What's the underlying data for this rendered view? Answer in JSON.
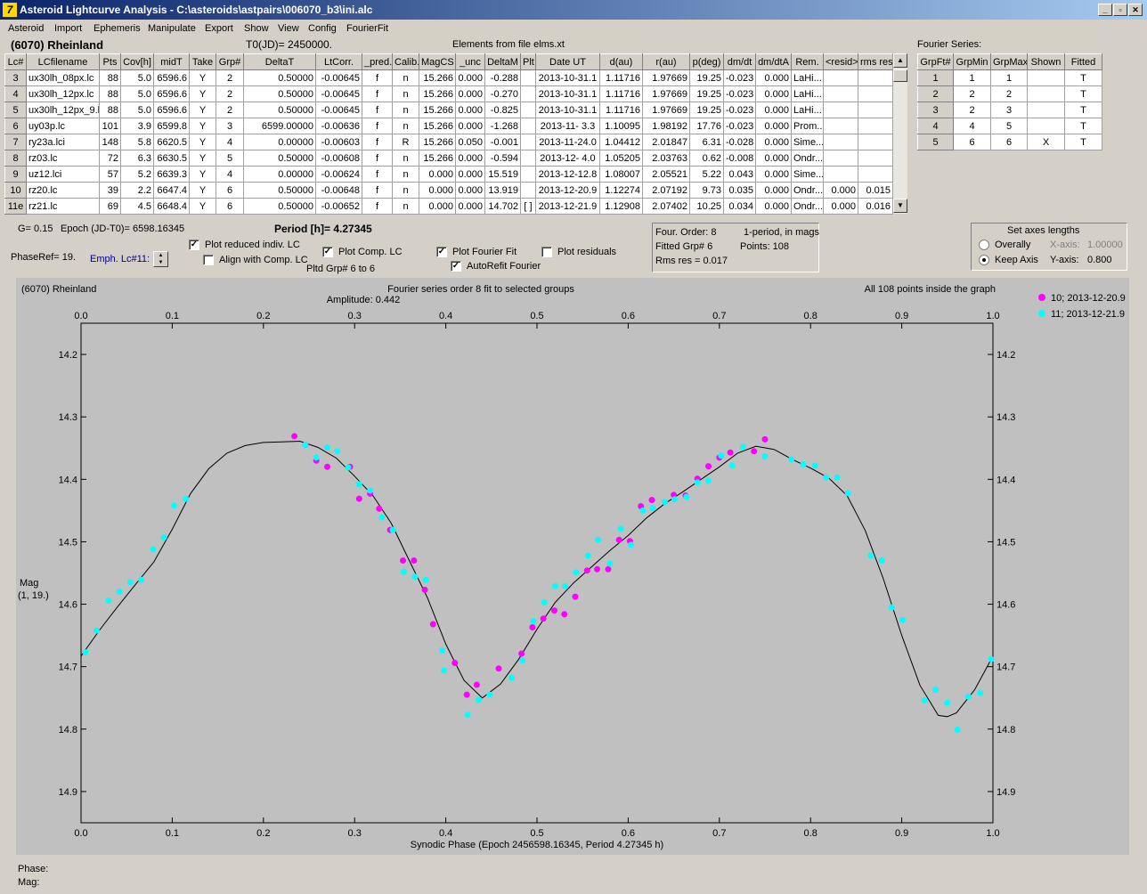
{
  "window": {
    "title": "Asteroid Lightcurve Analysis - C:\\asteroids\\astpairs\\006070_b3\\ini.alc",
    "logo": "7",
    "min": "_",
    "max": "▫",
    "close": "✕"
  },
  "menu": [
    "Asteroid",
    "Import",
    "Ephemeris",
    "Manipulate",
    "Export",
    "Show",
    "View",
    "Config",
    "FourierFit"
  ],
  "info": {
    "asteroid": "(6070) Rheinland",
    "t0": "T0(JD)= 2450000.",
    "elements": "Elements from file elms.xt",
    "fourier_label": "Fourier Series:"
  },
  "lc_table": {
    "headers": [
      "Lc#",
      "LCfilename",
      "Pts",
      "Cov[h]",
      "midT",
      "Take",
      "Grp#",
      "DeltaT",
      "LtCorr.",
      "_pred.",
      "Calib.",
      "MagCS",
      "_unc",
      "DeltaM",
      "Plt",
      "Date UT",
      "d(au)",
      "r(au)",
      "p(deg)",
      "dm/dt",
      "dm/dtA",
      "Rem.",
      "<resid>",
      "rms res"
    ],
    "rows": [
      [
        "3",
        "ux30lh_08px.lc",
        "88",
        "5.0",
        "6596.6",
        "Y",
        "2",
        "0.50000",
        "-0.00645",
        "f",
        "n",
        "15.266",
        "0.000",
        "-0.288",
        "",
        "2013-10-31.1",
        "1.11716",
        "1.97669",
        "19.25",
        "-0.023",
        "0.000",
        "LaHi...",
        "",
        ""
      ],
      [
        "4",
        "ux30lh_12px.lc",
        "88",
        "5.0",
        "6596.6",
        "Y",
        "2",
        "0.50000",
        "-0.00645",
        "f",
        "n",
        "15.266",
        "0.000",
        "-0.270",
        "",
        "2013-10-31.1",
        "1.11716",
        "1.97669",
        "19.25",
        "-0.023",
        "0.000",
        "LaHi...",
        "",
        ""
      ],
      [
        "5",
        "ux30lh_12px_9.l",
        "88",
        "5.0",
        "6596.6",
        "Y",
        "2",
        "0.50000",
        "-0.00645",
        "f",
        "n",
        "15.266",
        "0.000",
        "-0.825",
        "",
        "2013-10-31.1",
        "1.11716",
        "1.97669",
        "19.25",
        "-0.023",
        "0.000",
        "LaHi...",
        "",
        ""
      ],
      [
        "6",
        "uy03p.lc",
        "101",
        "3.9",
        "6599.8",
        "Y",
        "3",
        "6599.00000",
        "-0.00636",
        "f",
        "n",
        "15.266",
        "0.000",
        "-1.268",
        "",
        "2013-11- 3.3",
        "1.10095",
        "1.98192",
        "17.76",
        "-0.023",
        "0.000",
        "Prom...",
        "",
        ""
      ],
      [
        "7",
        "ry23a.lci",
        "148",
        "5.8",
        "6620.5",
        "Y",
        "4",
        "0.00000",
        "-0.00603",
        "f",
        "R",
        "15.266",
        "0.050",
        "-0.001",
        "",
        "2013-11-24.0",
        "1.04412",
        "2.01847",
        "6.31",
        "-0.028",
        "0.000",
        "Sime...",
        "",
        ""
      ],
      [
        "8",
        "rz03.lc",
        "72",
        "6.3",
        "6630.5",
        "Y",
        "5",
        "0.50000",
        "-0.00608",
        "f",
        "n",
        "15.266",
        "0.000",
        "-0.594",
        "",
        "2013-12- 4.0",
        "1.05205",
        "2.03763",
        "0.62",
        "-0.008",
        "0.000",
        "Ondr...",
        "",
        ""
      ],
      [
        "9",
        "uz12.lci",
        "57",
        "5.2",
        "6639.3",
        "Y",
        "4",
        "0.00000",
        "-0.00624",
        "f",
        "n",
        "0.000",
        "0.000",
        "15.519",
        "",
        "2013-12-12.8",
        "1.08007",
        "2.05521",
        "5.22",
        "0.043",
        "0.000",
        "Sime...",
        "",
        ""
      ],
      [
        "10",
        "rz20.lc",
        "39",
        "2.2",
        "6647.4",
        "Y",
        "6",
        "0.50000",
        "-0.00648",
        "f",
        "n",
        "0.000",
        "0.000",
        "13.919",
        "",
        "2013-12-20.9",
        "1.12274",
        "2.07192",
        "9.73",
        "0.035",
        "0.000",
        "Ondr...",
        "0.000",
        "0.015"
      ],
      [
        "11e",
        "rz21.lc",
        "69",
        "4.5",
        "6648.4",
        "Y",
        "6",
        "0.50000",
        "-0.00652",
        "f",
        "n",
        "0.000",
        "0.000",
        "14.702",
        "[ ]",
        "2013-12-21.9",
        "1.12908",
        "2.07402",
        "10.25",
        "0.034",
        "0.000",
        "Ondr...",
        "0.000",
        "0.016"
      ]
    ]
  },
  "fourier_table": {
    "headers": [
      "GrpFt#",
      "GrpMin",
      "GrpMax",
      "Shown",
      "Fitted"
    ],
    "rows": [
      [
        "1",
        "1",
        "1",
        "",
        "T"
      ],
      [
        "2",
        "2",
        "2",
        "",
        "T"
      ],
      [
        "3",
        "2",
        "3",
        "",
        "T"
      ],
      [
        "4",
        "4",
        "5",
        "",
        "T"
      ],
      [
        "5",
        "6",
        "6",
        "X",
        "T"
      ]
    ]
  },
  "controls": {
    "g": "G= 0.15",
    "epoch": "Epoch (JD-T0)= 6598.16345",
    "period": "Period [h]= 4.27345",
    "phaseref": "PhaseRef= 19.",
    "emph": "Emph. Lc#11:",
    "plot_reduced": "Plot reduced indiv. LC",
    "align": "Align with Comp. LC",
    "plot_comp": "Plot Comp. LC",
    "pltd_grp": "Pltd Grp#  6  to  6",
    "plot_fourier": "Plot Fourier Fit",
    "autorefit": "AutoRefit Fourier",
    "plot_resid": "Plot residuals",
    "checked": {
      "plot_reduced": true,
      "align": false,
      "plot_comp": true,
      "plot_fourier": true,
      "autorefit": true,
      "plot_resid": false
    }
  },
  "fit_info": {
    "order": "Four. Order:  8",
    "fitted": "Fitted Grp# 6",
    "rms": "Rms res     = 0.017",
    "mode": "1-period, in mags",
    "points": "Points: 108"
  },
  "axes_box": {
    "title": "Set axes lengths",
    "overall": "Overally",
    "keep": "Keep Axis",
    "xaxis": "X-axis:",
    "xval": "1.00000",
    "yaxis": "Y-axis:",
    "yval": "0.800",
    "selected": "keep"
  },
  "chart_data": {
    "type": "scatter",
    "title_left": "(6070) Rheinland",
    "title": "Fourier series order 8 fit to selected groups",
    "subtitle": "Amplitude: 0.442",
    "title_right": "All 108 points inside the graph",
    "xlabel": "Synodic Phase (Epoch 2456598.16345, Period 4.27345 h)",
    "ylabel": "Mag",
    "ylabel2": "(1, 19.)",
    "xlim": [
      0,
      1
    ],
    "ylim": [
      14.15,
      14.95
    ],
    "y_inverted": true,
    "xticks": [
      0.0,
      0.1,
      0.2,
      0.3,
      0.4,
      0.5,
      0.6,
      0.7,
      0.8,
      0.9,
      1.0
    ],
    "xtick_labels": [
      "0.0",
      "0.1",
      "0.2",
      "0.3",
      "0.4",
      "0.5",
      "0.6",
      "0.7",
      "0.8",
      "0.9",
      "1.0"
    ],
    "yticks": [
      14.2,
      14.3,
      14.4,
      14.5,
      14.6,
      14.7,
      14.8,
      14.9
    ],
    "ytick_labels": [
      "14.2",
      "14.3",
      "14.4",
      "14.5",
      "14.6",
      "14.7",
      "14.8",
      "14.9"
    ],
    "legend": "right",
    "series": [
      {
        "name": "10; 2013-12-20.9",
        "color": "#ff00ff",
        "points": [
          [
            0.234,
            14.331
          ],
          [
            0.246,
            14.345
          ],
          [
            0.258,
            14.37
          ],
          [
            0.27,
            14.38
          ],
          [
            0.295,
            14.38
          ],
          [
            0.305,
            14.431
          ],
          [
            0.317,
            14.423
          ],
          [
            0.327,
            14.447
          ],
          [
            0.339,
            14.481
          ],
          [
            0.353,
            14.53
          ],
          [
            0.365,
            14.53
          ],
          [
            0.377,
            14.577
          ],
          [
            0.386,
            14.632
          ],
          [
            0.41,
            14.694
          ],
          [
            0.423,
            14.745
          ],
          [
            0.434,
            14.729
          ],
          [
            0.458,
            14.703
          ],
          [
            0.483,
            14.679
          ],
          [
            0.495,
            14.637
          ],
          [
            0.507,
            14.623
          ],
          [
            0.519,
            14.61
          ],
          [
            0.53,
            14.616
          ],
          [
            0.542,
            14.588
          ],
          [
            0.555,
            14.546
          ],
          [
            0.566,
            14.544
          ],
          [
            0.578,
            14.544
          ],
          [
            0.59,
            14.497
          ],
          [
            0.602,
            14.499
          ],
          [
            0.614,
            14.443
          ],
          [
            0.626,
            14.433
          ],
          [
            0.65,
            14.425
          ],
          [
            0.663,
            14.426
          ],
          [
            0.676,
            14.399
          ],
          [
            0.688,
            14.379
          ],
          [
            0.7,
            14.365
          ],
          [
            0.712,
            14.357
          ],
          [
            0.738,
            14.355
          ],
          [
            0.75,
            14.336
          ]
        ]
      },
      {
        "name": "11; 2013-12-21.9",
        "color": "#00ffff",
        "points": [
          [
            0.005,
            14.677
          ],
          [
            0.017,
            14.642
          ],
          [
            0.03,
            14.594
          ],
          [
            0.042,
            14.58
          ],
          [
            0.054,
            14.565
          ],
          [
            0.066,
            14.561
          ],
          [
            0.079,
            14.512
          ],
          [
            0.091,
            14.493
          ],
          [
            0.102,
            14.442
          ],
          [
            0.115,
            14.431
          ],
          [
            0.246,
            14.345
          ],
          [
            0.258,
            14.365
          ],
          [
            0.27,
            14.349
          ],
          [
            0.281,
            14.355
          ],
          [
            0.293,
            14.381
          ],
          [
            0.305,
            14.408
          ],
          [
            0.317,
            14.418
          ],
          [
            0.33,
            14.461
          ],
          [
            0.342,
            14.481
          ],
          [
            0.354,
            14.548
          ],
          [
            0.366,
            14.556
          ],
          [
            0.378,
            14.561
          ],
          [
            0.396,
            14.674
          ],
          [
            0.398,
            14.706
          ],
          [
            0.424,
            14.777
          ],
          [
            0.436,
            14.753
          ],
          [
            0.448,
            14.745
          ],
          [
            0.472,
            14.718
          ],
          [
            0.484,
            14.69
          ],
          [
            0.496,
            14.627
          ],
          [
            0.508,
            14.597
          ],
          [
            0.52,
            14.571
          ],
          [
            0.531,
            14.571
          ],
          [
            0.543,
            14.549
          ],
          [
            0.556,
            14.522
          ],
          [
            0.567,
            14.497
          ],
          [
            0.58,
            14.535
          ],
          [
            0.592,
            14.479
          ],
          [
            0.603,
            14.505
          ],
          [
            0.616,
            14.45
          ],
          [
            0.627,
            14.446
          ],
          [
            0.64,
            14.436
          ],
          [
            0.651,
            14.432
          ],
          [
            0.664,
            14.428
          ],
          [
            0.676,
            14.405
          ],
          [
            0.688,
            14.402
          ],
          [
            0.702,
            14.362
          ],
          [
            0.714,
            14.378
          ],
          [
            0.726,
            14.348
          ],
          [
            0.75,
            14.363
          ],
          [
            0.779,
            14.368
          ],
          [
            0.792,
            14.376
          ],
          [
            0.805,
            14.378
          ],
          [
            0.817,
            14.397
          ],
          [
            0.829,
            14.397
          ],
          [
            0.841,
            14.422
          ],
          [
            0.866,
            14.522
          ],
          [
            0.878,
            14.53
          ],
          [
            0.889,
            14.605
          ],
          [
            0.901,
            14.625
          ],
          [
            0.925,
            14.754
          ],
          [
            0.937,
            14.737
          ],
          [
            0.95,
            14.758
          ],
          [
            0.961,
            14.801
          ],
          [
            0.973,
            14.748
          ],
          [
            0.986,
            14.742
          ],
          [
            0.998,
            14.688
          ]
        ]
      }
    ],
    "fit_curve": [
      [
        0.0,
        14.683
      ],
      [
        0.02,
        14.642
      ],
      [
        0.04,
        14.604
      ],
      [
        0.06,
        14.568
      ],
      [
        0.08,
        14.532
      ],
      [
        0.1,
        14.48
      ],
      [
        0.12,
        14.423
      ],
      [
        0.14,
        14.383
      ],
      [
        0.16,
        14.358
      ],
      [
        0.18,
        14.346
      ],
      [
        0.2,
        14.341
      ],
      [
        0.22,
        14.34
      ],
      [
        0.24,
        14.339
      ],
      [
        0.26,
        14.349
      ],
      [
        0.28,
        14.366
      ],
      [
        0.3,
        14.395
      ],
      [
        0.32,
        14.426
      ],
      [
        0.34,
        14.47
      ],
      [
        0.36,
        14.53
      ],
      [
        0.38,
        14.59
      ],
      [
        0.4,
        14.664
      ],
      [
        0.42,
        14.722
      ],
      [
        0.44,
        14.75
      ],
      [
        0.46,
        14.728
      ],
      [
        0.48,
        14.688
      ],
      [
        0.5,
        14.64
      ],
      [
        0.52,
        14.597
      ],
      [
        0.54,
        14.566
      ],
      [
        0.56,
        14.54
      ],
      [
        0.58,
        14.514
      ],
      [
        0.6,
        14.49
      ],
      [
        0.62,
        14.462
      ],
      [
        0.64,
        14.439
      ],
      [
        0.66,
        14.42
      ],
      [
        0.68,
        14.4
      ],
      [
        0.7,
        14.38
      ],
      [
        0.72,
        14.358
      ],
      [
        0.74,
        14.347
      ],
      [
        0.76,
        14.352
      ],
      [
        0.78,
        14.368
      ],
      [
        0.8,
        14.382
      ],
      [
        0.82,
        14.398
      ],
      [
        0.84,
        14.426
      ],
      [
        0.86,
        14.482
      ],
      [
        0.88,
        14.56
      ],
      [
        0.9,
        14.65
      ],
      [
        0.92,
        14.73
      ],
      [
        0.94,
        14.778
      ],
      [
        0.95,
        14.78
      ],
      [
        0.96,
        14.774
      ],
      [
        0.98,
        14.737
      ],
      [
        1.0,
        14.683
      ]
    ]
  },
  "status": {
    "phase": "Phase:",
    "mag": "Mag:"
  }
}
